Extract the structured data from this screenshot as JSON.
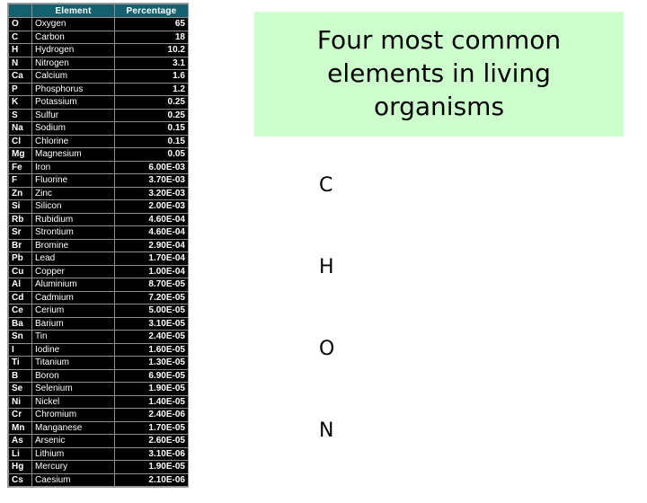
{
  "slide": {
    "background_color": "#ffffff",
    "title_banner": {
      "text": "Four most common elements in living organisms",
      "background_color": "#ccffcc",
      "text_color": "#000000"
    },
    "four_elements": [
      {
        "symbol": "C"
      },
      {
        "symbol": "H"
      },
      {
        "symbol": "O"
      },
      {
        "symbol": "N"
      }
    ]
  },
  "composition_table": {
    "header_background": "#15606e",
    "body_background": "#000000",
    "columns": [
      "",
      "Element",
      "Percentage"
    ],
    "rows": [
      {
        "symbol": "O",
        "name": "Oxygen",
        "percentage": "65"
      },
      {
        "symbol": "C",
        "name": "Carbon",
        "percentage": "18"
      },
      {
        "symbol": "H",
        "name": "Hydrogen",
        "percentage": "10.2"
      },
      {
        "symbol": "N",
        "name": "Nitrogen",
        "percentage": "3.1"
      },
      {
        "symbol": "Ca",
        "name": "Calcium",
        "percentage": "1.6"
      },
      {
        "symbol": "P",
        "name": "Phosphorus",
        "percentage": "1.2"
      },
      {
        "symbol": "K",
        "name": "Potassium",
        "percentage": "0.25"
      },
      {
        "symbol": "S",
        "name": "Sulfur",
        "percentage": "0.25"
      },
      {
        "symbol": "Na",
        "name": "Sodium",
        "percentage": "0.15"
      },
      {
        "symbol": "Cl",
        "name": "Chlorine",
        "percentage": "0.15"
      },
      {
        "symbol": "Mg",
        "name": "Magnesium",
        "percentage": "0.05"
      },
      {
        "symbol": "Fe",
        "name": "Iron",
        "percentage": "6.00E-03"
      },
      {
        "symbol": "F",
        "name": "Fluorine",
        "percentage": "3.70E-03"
      },
      {
        "symbol": "Zn",
        "name": "Zinc",
        "percentage": "3.20E-03"
      },
      {
        "symbol": "Si",
        "name": "Silicon",
        "percentage": "2.00E-03"
      },
      {
        "symbol": "Rb",
        "name": "Rubidium",
        "percentage": "4.60E-04"
      },
      {
        "symbol": "Sr",
        "name": "Strontium",
        "percentage": "4.60E-04"
      },
      {
        "symbol": "Br",
        "name": "Bromine",
        "percentage": "2.90E-04"
      },
      {
        "symbol": "Pb",
        "name": "Lead",
        "percentage": "1.70E-04"
      },
      {
        "symbol": "Cu",
        "name": "Copper",
        "percentage": "1.00E-04"
      },
      {
        "symbol": "Al",
        "name": "Aluminium",
        "percentage": "8.70E-05"
      },
      {
        "symbol": "Cd",
        "name": "Cadmium",
        "percentage": "7.20E-05"
      },
      {
        "symbol": "Ce",
        "name": "Cerium",
        "percentage": "5.00E-05"
      },
      {
        "symbol": "Ba",
        "name": "Barium",
        "percentage": "3.10E-05"
      },
      {
        "symbol": "Sn",
        "name": "Tin",
        "percentage": "2.40E-05"
      },
      {
        "symbol": "I",
        "name": "Iodine",
        "percentage": "1.60E-05"
      },
      {
        "symbol": "Ti",
        "name": "Titanium",
        "percentage": "1.30E-05"
      },
      {
        "symbol": "B",
        "name": "Boron",
        "percentage": "6.90E-05"
      },
      {
        "symbol": "Se",
        "name": "Selenium",
        "percentage": "1.90E-05"
      },
      {
        "symbol": "Ni",
        "name": "Nickel",
        "percentage": "1.40E-05"
      },
      {
        "symbol": "Cr",
        "name": "Chromium",
        "percentage": "2.40E-06"
      },
      {
        "symbol": "Mn",
        "name": "Manganese",
        "percentage": "1.70E-05"
      },
      {
        "symbol": "As",
        "name": "Arsenic",
        "percentage": "2.60E-05"
      },
      {
        "symbol": "Li",
        "name": "Lithium",
        "percentage": "3.10E-06"
      },
      {
        "symbol": "Hg",
        "name": "Mercury",
        "percentage": "1.90E-05"
      },
      {
        "symbol": "Cs",
        "name": "Caesium",
        "percentage": "2.10E-06"
      }
    ]
  }
}
